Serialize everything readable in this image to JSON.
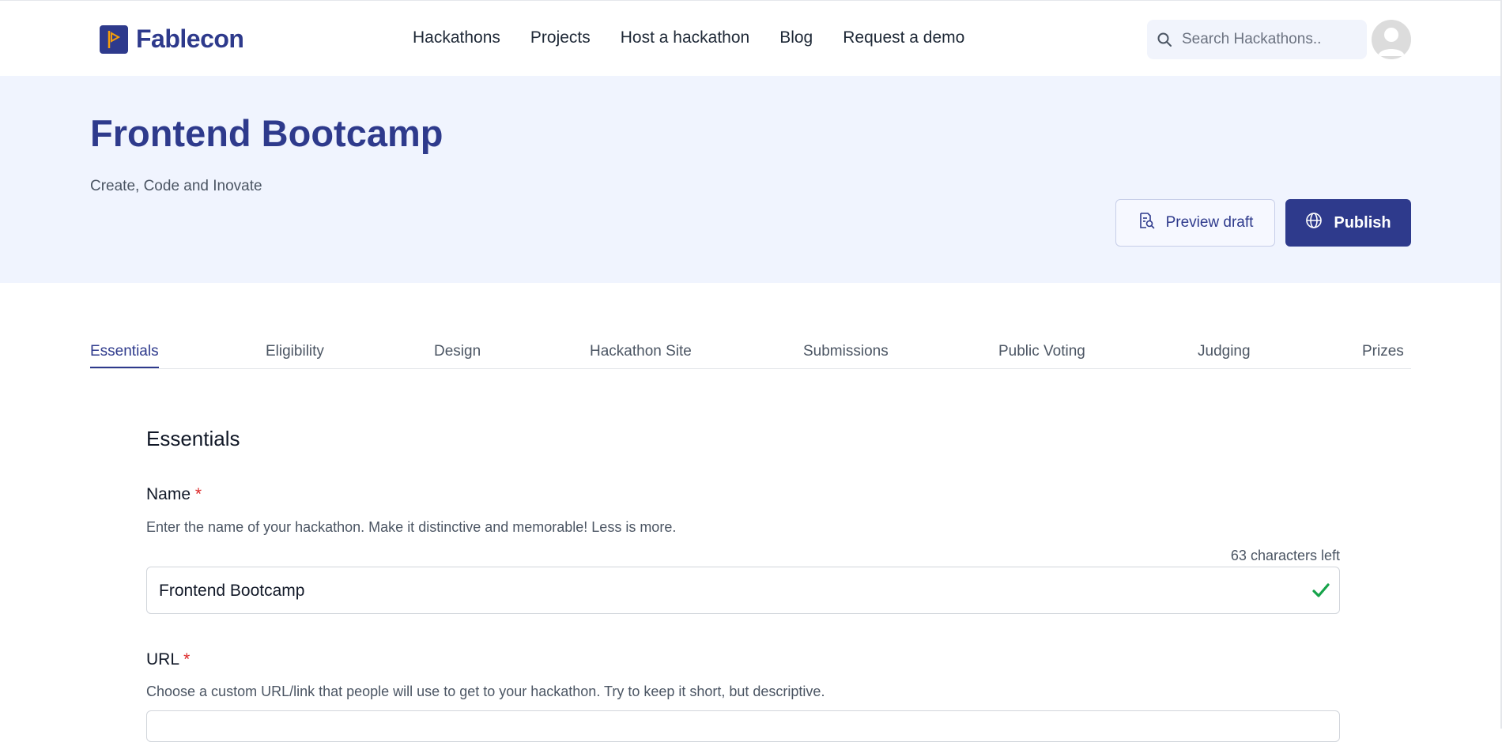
{
  "brand": {
    "name": "Fablecon",
    "color": "#2e3a8c"
  },
  "nav": {
    "items": [
      "Hackathons",
      "Projects",
      "Host a hackathon",
      "Blog",
      "Request a demo"
    ]
  },
  "search": {
    "placeholder": "Search Hackathons.."
  },
  "hero": {
    "title": "Frontend Bootcamp",
    "subtitle": "Create, Code and Inovate",
    "preview_label": "Preview draft",
    "publish_label": "Publish"
  },
  "tabs": {
    "active": "Essentials",
    "items": [
      "Essentials",
      "Eligibility",
      "Design",
      "Hackathon Site",
      "Submissions",
      "Public Voting",
      "Judging",
      "Prizes"
    ]
  },
  "form": {
    "section_title": "Essentials",
    "name": {
      "label": "Name",
      "required_mark": "*",
      "help": "Enter the name of your hackathon. Make it distinctive and memorable! Less is more.",
      "counter": "63 characters left",
      "value": "Frontend Bootcamp",
      "status_color": "#16a34a"
    },
    "url": {
      "label": "URL",
      "required_mark": "*",
      "help": "Choose a custom URL/link that people will use to get to your hackathon. Try to keep it short, but descriptive."
    }
  },
  "icons": {
    "search": "search-icon",
    "avatar": "user-avatar-icon",
    "preview": "document-search-icon",
    "publish": "globe-icon",
    "valid": "check-icon"
  }
}
